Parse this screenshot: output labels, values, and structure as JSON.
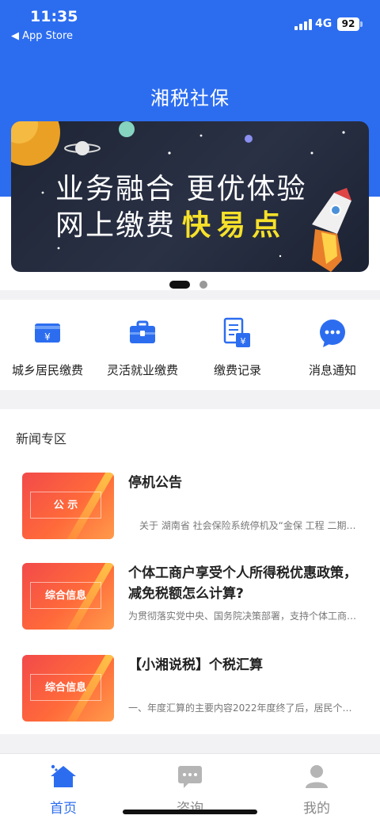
{
  "status_bar": {
    "time": "11:35",
    "back_label": "◀ App Store",
    "network": "4G",
    "battery": "92"
  },
  "header": {
    "title": "湘税社保"
  },
  "banner": {
    "line1": "业务融合 更优体验",
    "line2_prefix": "网上缴费",
    "line2_highlight": "快易点"
  },
  "carousel": {
    "active_index": 0,
    "count": 2
  },
  "quick_actions": [
    {
      "label": "城乡居民缴费",
      "icon": "yuan-card-icon"
    },
    {
      "label": "灵活就业缴费",
      "icon": "briefcase-icon"
    },
    {
      "label": "缴费记录",
      "icon": "record-document-icon"
    },
    {
      "label": "消息通知",
      "icon": "message-bubble-icon"
    }
  ],
  "news": {
    "section_title": "新闻专区",
    "items": [
      {
        "thumb_label": "公 示",
        "headline": "停机公告",
        "summary": "关于 湖南省 社会保险系统停机及“金保 工程 二期…"
      },
      {
        "thumb_label": "综合信息",
        "headline": "个体工商户享受个人所得税优惠政策，减免税额怎么计算?",
        "summary": "为贯彻落实党中央、国务院决策部署，支持个体工商…"
      },
      {
        "thumb_label": "综合信息",
        "headline": "【小湘说税】个税汇算",
        "summary": "一、年度汇算的主要内容2022年度终了后，居民个…"
      }
    ]
  },
  "tabbar": [
    {
      "label": "首页",
      "icon": "home-icon",
      "active": true
    },
    {
      "label": "咨询",
      "icon": "chat-icon",
      "active": false
    },
    {
      "label": "我的",
      "icon": "user-icon",
      "active": false
    }
  ],
  "colors": {
    "brand_blue": "#2c6df0",
    "banner_yellow": "#f6e12a"
  }
}
